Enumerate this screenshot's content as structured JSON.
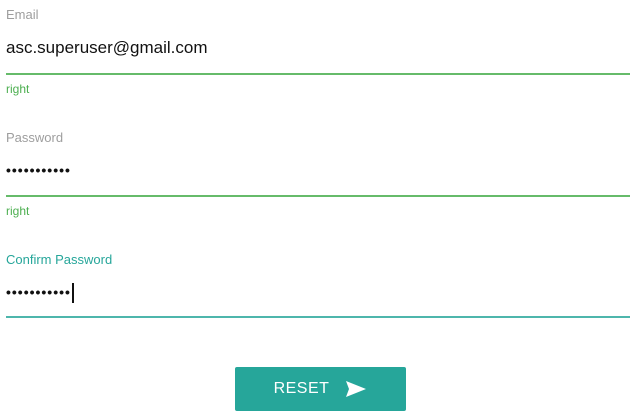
{
  "form": {
    "email": {
      "label": "Email",
      "value": "asc.superuser@gmail.com",
      "helper": "right"
    },
    "password": {
      "label": "Password",
      "value": "•••••••••••",
      "helper": "right"
    },
    "confirm_password": {
      "label": "Confirm Password",
      "value": "•••••••••••"
    },
    "reset_button": {
      "label": "RESET",
      "icon": "send-icon"
    }
  },
  "colors": {
    "accent": "#26a69a",
    "valid": "#4caf50",
    "label": "#9e9e9e"
  }
}
